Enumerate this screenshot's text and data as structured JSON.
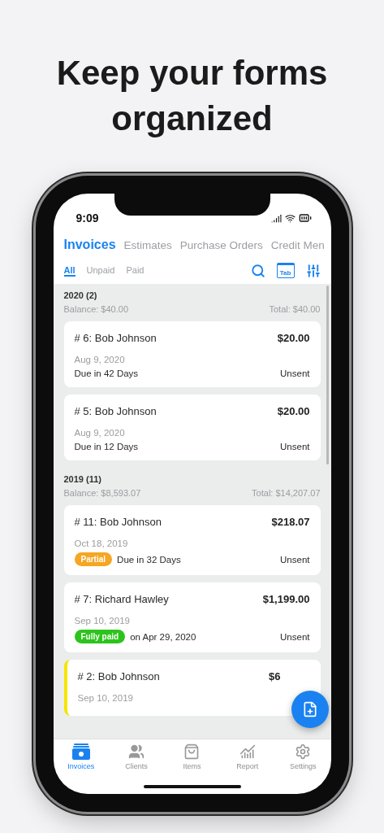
{
  "headline": "Keep your forms organized",
  "status_bar": {
    "time": "9:09"
  },
  "doc_tabs": [
    {
      "label": "Invoices",
      "selected": true
    },
    {
      "label": "Estimates",
      "selected": false
    },
    {
      "label": "Purchase Orders",
      "selected": false
    },
    {
      "label": "Credit Men",
      "selected": false
    }
  ],
  "filter_tabs": [
    {
      "label": "All",
      "selected": true
    },
    {
      "label": "Unpaid",
      "selected": false
    },
    {
      "label": "Paid",
      "selected": false
    }
  ],
  "toolbar": {
    "tab_view_label": "Tab"
  },
  "groups": [
    {
      "title": "2020 (2)",
      "balance": "Balance: $40.00",
      "total": "Total: $40.00",
      "invoices": [
        {
          "title": "# 6: Bob  Johnson",
          "amount": "$20.00",
          "date": "Aug 9, 2020",
          "due": "Due in 42 Days",
          "send_status": "Unsent",
          "highlighted": false
        },
        {
          "title": "# 5: Bob  Johnson",
          "amount": "$20.00",
          "date": "Aug 9, 2020",
          "due": "Due in 12 Days",
          "send_status": "Unsent",
          "highlighted": false
        }
      ]
    },
    {
      "title": "2019 (11)",
      "balance": "Balance: $8,593.07",
      "total": "Total: $14,207.07",
      "invoices": [
        {
          "title": "# 11: Bob  Johnson",
          "amount": "$218.07",
          "date": "Oct 18, 2019",
          "badge": {
            "label": "Partial",
            "kind": "partial"
          },
          "due": "Due in 32 Days",
          "send_status": "Unsent",
          "highlighted": false
        },
        {
          "title": "# 7: Richard  Hawley",
          "amount": "$1,199.00",
          "date": "Sep 10, 2019",
          "badge": {
            "label": "Fully paid",
            "kind": "paid"
          },
          "due": "on Apr 29, 2020",
          "send_status": "Unsent",
          "highlighted": false
        },
        {
          "title": "# 2: Bob  Johnson",
          "amount": "$6",
          "date": "Sep 10, 2019",
          "highlighted": true
        }
      ]
    }
  ],
  "nav": [
    {
      "label": "Invoices",
      "kind": "invoices",
      "selected": true
    },
    {
      "label": "Clients",
      "kind": "clients",
      "selected": false
    },
    {
      "label": "Items",
      "kind": "items",
      "selected": false
    },
    {
      "label": "Report",
      "kind": "report",
      "selected": false
    },
    {
      "label": "Settings",
      "kind": "settings",
      "selected": false
    }
  ]
}
